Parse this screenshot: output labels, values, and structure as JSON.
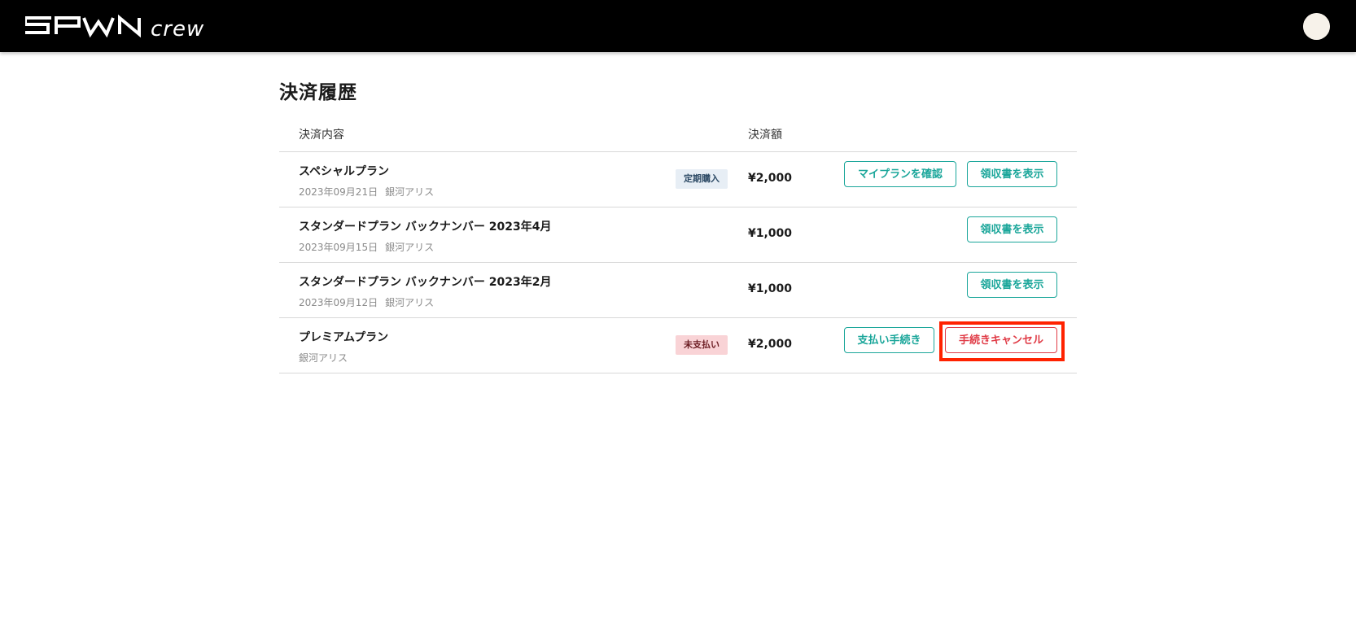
{
  "header": {
    "brand": "SPWN crew",
    "colors": {
      "bar": "#000000",
      "brand_text": "#ffffff",
      "avatar_accent": "#f0a840"
    }
  },
  "page": {
    "title": "決済履歴"
  },
  "table": {
    "columns": {
      "content": "決済内容",
      "amount": "決済額"
    },
    "rows": [
      {
        "name": "スペシャルプラン",
        "date": "2023年09月21日",
        "creator": "銀河アリス",
        "badge": "定期購入",
        "badge_type": "recurring",
        "price": "¥2,000",
        "buttons": [
          {
            "label": "マイプランを確認",
            "type": "primary"
          },
          {
            "label": "領収書を表示",
            "type": "primary"
          }
        ]
      },
      {
        "name": "スタンダードプラン バックナンバー 2023年4月",
        "date": "2023年09月15日",
        "creator": "銀河アリス",
        "price": "¥1,000",
        "buttons": [
          {
            "label": "領収書を表示",
            "type": "primary"
          }
        ]
      },
      {
        "name": "スタンダードプラン バックナンバー 2023年2月",
        "date": "2023年09月12日",
        "creator": "銀河アリス",
        "price": "¥1,000",
        "buttons": [
          {
            "label": "領収書を表示",
            "type": "primary"
          }
        ]
      },
      {
        "name": "プレミアムプラン",
        "creator": "銀河アリス",
        "badge": "未支払い",
        "badge_type": "unpaid",
        "price": "¥2,000",
        "buttons": [
          {
            "label": "支払い手続き",
            "type": "primary"
          },
          {
            "label": "手続きキャンセル",
            "type": "danger"
          }
        ]
      }
    ]
  },
  "colors": {
    "accent": "#1aa69a",
    "danger": "#e03b46",
    "highlight": "#ff2200"
  }
}
